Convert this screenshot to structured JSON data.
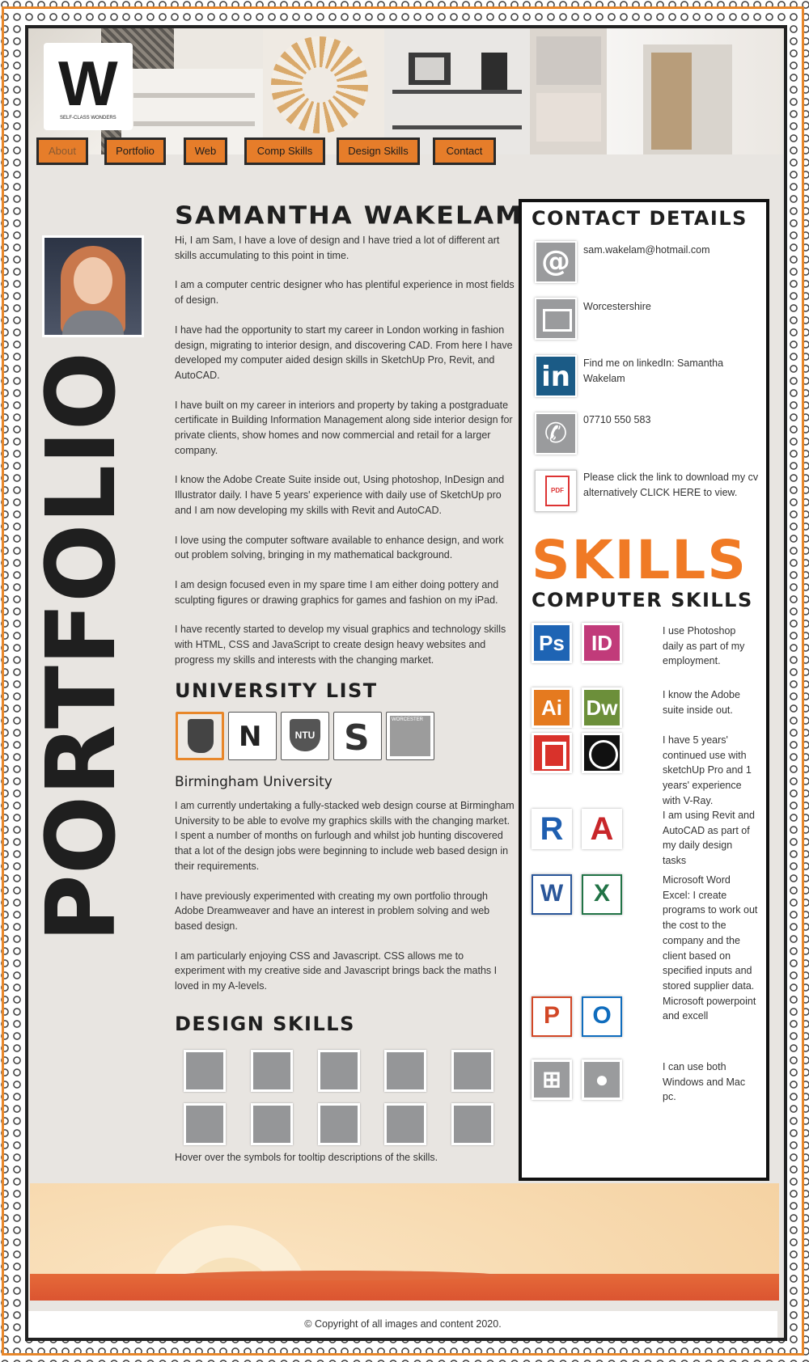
{
  "nav": [
    "About",
    "Portfolio",
    "Web",
    "Comp Skills",
    "Design Skills",
    "Contact"
  ],
  "logo": {
    "letter": "W",
    "tagline": "SELF-CLASS WONDERS"
  },
  "side_title": "PORTFOLIO",
  "name": "SAMANTHA WAKELAM",
  "about": [
    "Hi, I am Sam, I have a love of design and I have tried a lot of different art skills accumulating to this point in time.",
    "I am a computer centric designer who has plentiful experience in most fields of design.",
    "I have had the opportunity to start my career in London working in fashion design, migrating to interior design, and discovering CAD. From here I have developed my computer aided design skills in SketchUp Pro, Revit, and AutoCAD.",
    "I have built on my career in interiors and property by taking a postgraduate certificate in Building Information Management along side interior design for private clients, show homes and now commercial and retail for a larger company.",
    "I know the Adobe Create Suite inside out, Using photoshop, InDesign and Illustrator daily. I have 5 years' experience with daily use of SketchUp pro and I am now developing my skills with Revit and AutoCAD.",
    "I love using the computer software available to enhance design, and work out problem solving, bringing in my mathematical background.",
    "I am design focused even in my spare time I am either doing pottery and sculpting figures or drawing graphics for games and fashion on my iPad.",
    "I have recently started to develop my visual graphics and technology skills with HTML, CSS and JavaScript to create design heavy websites and progress my skills and interests with the changing market."
  ],
  "university_heading": "UNIVERSITY LIST",
  "universities": [
    "NTU",
    "WORCESTER"
  ],
  "uni_title": "Birmingham University",
  "uni_text": [
    "I am currently undertaking a fully-stacked web design course at Birmingham University to be able to evolve my graphics skills with the changing market. I spent a number of months on furlough and whilst job hunting discovered that a lot of the design jobs were beginning to include web based design in their requirements.",
    "I have previously experimented with creating my own portfolio through Adobe Dreamweaver and have an interest in problem solving and web based design.",
    "I am particularly enjoying CSS and Javascript. CSS allows me to experiment with my creative side and Javascript brings back the maths I loved in my A-levels."
  ],
  "design_heading": "DESIGN SKILLS",
  "design_hint": "Hover over the symbols for tooltip descriptions of the skills.",
  "contact_heading": "CONTACT DETAILS",
  "contact": {
    "email": "sam.wakelam@hotmail.com",
    "location": "Worcestershire",
    "linkedin": "Find me on linkedIn: Samantha Wakelam",
    "phone": "07710 550 583",
    "cv": "Please click the link to download my cv alternatively CLICK HERE to view."
  },
  "skills_heading": "SKILLS",
  "computer_heading": "COMPUTER SKILLS",
  "apps": [
    "Ps",
    "ID",
    "Ai",
    "Dw",
    "W",
    "X",
    "P",
    "O"
  ],
  "computer_skills": [
    "I use Photoshop daily as part of my employment.",
    "I know the Adobe suite inside out.",
    "I have 5 years' continued use with sketchUp Pro and 1 years' experience with V-Ray.",
    "I am using Revit and AutoCAD as part of my daily design tasks",
    "Microsoft Word Excel: I create programs to work out the cost to the company and the client based on specified inputs and stored supplier data. Microsoft powerpoint and excell",
    "I can use both Windows and Mac pc."
  ],
  "footer": "© Copyright of all images and content 2020.",
  "colors": {
    "accent": "#e8872a",
    "dark": "#1f1f1f",
    "panel": "#e8e5e1"
  }
}
